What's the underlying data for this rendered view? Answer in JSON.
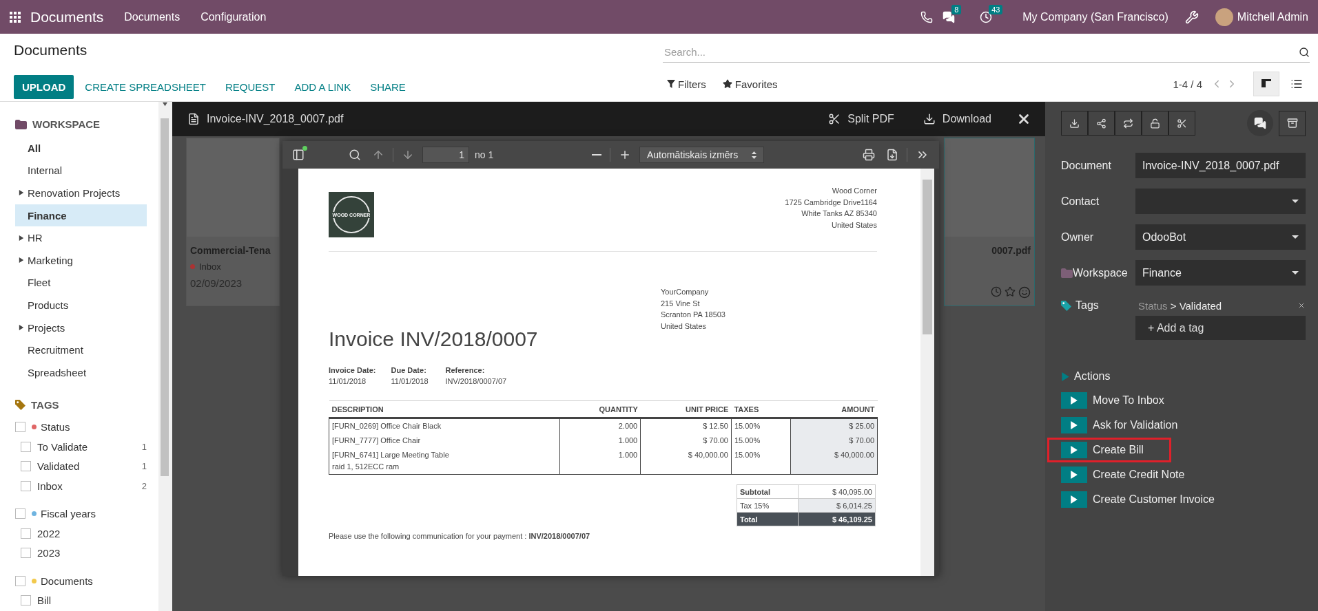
{
  "navbar": {
    "app_name": "Documents",
    "menus": [
      "Documents",
      "Configuration"
    ],
    "messages_badge": "8",
    "activities_badge": "43",
    "company": "My Company (San Francisco)",
    "user": "Mitchell Admin"
  },
  "control_panel": {
    "breadcrumb": "Documents",
    "search": {
      "placeholder": "Search..."
    },
    "buttons": [
      {
        "label": "UPLOAD",
        "kind": "primary"
      },
      {
        "label": "CREATE SPREADSHEET",
        "kind": "link"
      },
      {
        "label": "REQUEST",
        "kind": "link"
      },
      {
        "label": "ADD A LINK",
        "kind": "link"
      },
      {
        "label": "SHARE",
        "kind": "link"
      }
    ],
    "filters": "Filters",
    "favorites": "Favorites",
    "pager": "1-4 / 4",
    "views": [
      {
        "kind": "kanban",
        "selected": true
      },
      {
        "kind": "list",
        "selected": false
      }
    ]
  },
  "sidebar": {
    "workspace_title": "WORKSPACE",
    "workspaces": [
      {
        "label": "All",
        "kind": "all",
        "selected": false
      },
      {
        "label": "Internal",
        "kind": "folder",
        "selected": false
      },
      {
        "label": "Renovation Projects",
        "kind": "parent",
        "selected": false
      },
      {
        "label": "Finance",
        "kind": "folder",
        "selected": true
      },
      {
        "label": "HR",
        "kind": "parent",
        "selected": false
      },
      {
        "label": "Marketing",
        "kind": "parent",
        "selected": false
      },
      {
        "label": "Fleet",
        "kind": "folder",
        "selected": false
      },
      {
        "label": "Products",
        "kind": "folder",
        "selected": false
      },
      {
        "label": "Projects",
        "kind": "parent",
        "selected": false
      },
      {
        "label": "Recruitment",
        "kind": "folder",
        "selected": false
      },
      {
        "label": "Spreadsheet",
        "kind": "folder",
        "selected": false
      }
    ],
    "tags_title": "TAGS",
    "tag_groups": [
      {
        "label": "Status",
        "color": "#e06666",
        "checked": false,
        "children": [
          {
            "label": "To Validate",
            "count": "1",
            "checked": false
          },
          {
            "label": "Validated",
            "count": "1",
            "checked": false
          },
          {
            "label": "Inbox",
            "count": "2",
            "checked": false
          }
        ]
      },
      {
        "label": "Fiscal years",
        "color": "#6fb4e0",
        "checked": false,
        "children": [
          {
            "label": "2022",
            "checked": false
          },
          {
            "label": "2023",
            "checked": false
          }
        ]
      },
      {
        "label": "Documents",
        "color": "#f2c94c",
        "checked": false,
        "children": [
          {
            "label": "Bill",
            "checked": false
          }
        ]
      }
    ]
  },
  "background_cards": [
    {
      "kind": "left",
      "title": "Commercial-Tena",
      "tag": "Inbox",
      "date": "02/09/2023",
      "selected": false
    },
    {
      "kind": "right",
      "title": "0007.pdf",
      "selected": true
    }
  ],
  "viewer": {
    "file_name": "Invoice-INV_2018_0007.pdf",
    "split_label": "Split PDF",
    "download_label": "Download",
    "pdf_toolbar": {
      "page": "1",
      "page_total": "no 1",
      "zoom": "Automātiskais izmērs"
    },
    "invoice": {
      "logo_text": "WOOD CORNER",
      "vendor_address": [
        "Wood Corner",
        "1725 Cambridge Drive1164",
        "White Tanks AZ 85340",
        "United States"
      ],
      "customer_address": [
        "YourCompany",
        "215 Vine St",
        "Scranton PA 18503",
        "United States"
      ],
      "title": "Invoice INV/2018/0007",
      "info": [
        {
          "label": "Invoice Date:",
          "value": "11/01/2018"
        },
        {
          "label": "Due Date:",
          "value": "11/01/2018"
        },
        {
          "label": "Reference:",
          "value": "INV/2018/0007/07"
        }
      ],
      "columns": [
        "DESCRIPTION",
        "QUANTITY",
        "UNIT PRICE",
        "TAXES",
        "AMOUNT"
      ],
      "rows": [
        {
          "cells": [
            "[FURN_0269] Office Chair Black",
            "2.000",
            "$ 12.50",
            "15.00%",
            "$ 25.00"
          ]
        },
        {
          "cells": [
            "[FURN_7777] Office Chair",
            "1.000",
            "$ 70.00",
            "15.00%",
            "$ 70.00"
          ]
        },
        {
          "cells": [
            "[FURN_6741] Large Meeting Table",
            "1.000",
            "$ 40,000.00",
            "15.00%",
            "$ 40,000.00"
          ],
          "note": "raid 1, 512ECC ram"
        }
      ],
      "totals": [
        {
          "kind": "subtotal",
          "label": "Subtotal",
          "value": "$ 40,095.00"
        },
        {
          "kind": "tax",
          "label": "Tax 15%",
          "value": "$ 6,014.25"
        },
        {
          "kind": "total",
          "label": "Total",
          "value": "$ 46,109.25"
        }
      ],
      "payment_note": "Please use the following communication for your payment : **INV/2018/0007/07**"
    }
  },
  "details": {
    "fields": [
      {
        "label": "Document",
        "kind": "text",
        "value": "Invoice-INV_2018_0007.pdf"
      },
      {
        "label": "Contact",
        "kind": "select"
      },
      {
        "label": "Owner",
        "kind": "select",
        "value": "OdooBot"
      },
      {
        "label": "Workspace",
        "kind": "workspace",
        "value": "Finance"
      }
    ],
    "tags": {
      "label": "Tags",
      "items": [
        {
          "group": "Status",
          "separator": ">",
          "name": "Validated"
        }
      ],
      "placeholder": "+ Add a tag"
    },
    "actions": {
      "title": "Actions",
      "items": [
        {
          "label": "Move To Inbox",
          "highlighted": false
        },
        {
          "label": "Ask for Validation",
          "highlighted": false
        },
        {
          "label": "Create Bill",
          "highlighted": true
        },
        {
          "label": "Create Credit Note",
          "highlighted": false
        },
        {
          "label": "Create Customer Invoice",
          "highlighted": false
        }
      ]
    }
  }
}
